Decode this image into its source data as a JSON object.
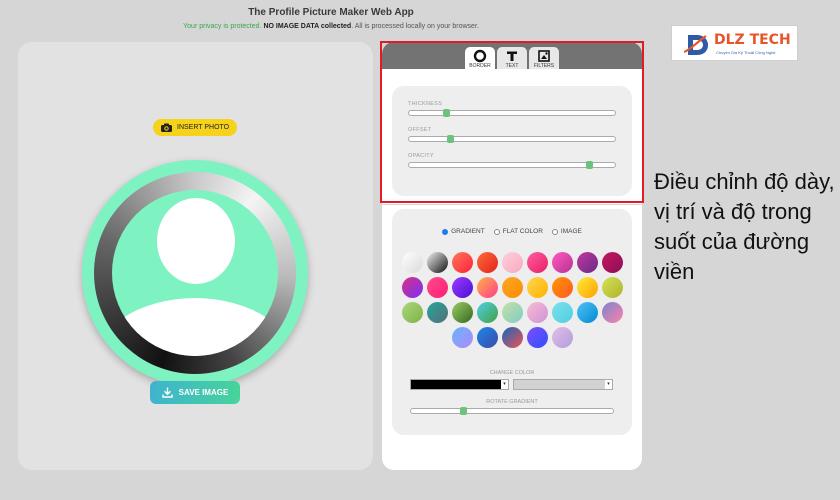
{
  "header": {
    "title": "The Profile Picture Maker Web App",
    "privacy_green": "Your privacy is protected.",
    "privacy_bold": "NO IMAGE DATA collected",
    "privacy_rest": ". All is processed locally on your browser."
  },
  "left": {
    "insert_label": "INSERT PHOTO",
    "save_label": "SAVE IMAGE"
  },
  "tabs": [
    {
      "label": "BORDER",
      "icon": "circle-icon",
      "active": true
    },
    {
      "label": "TEXT",
      "icon": "text-t-icon",
      "active": false
    },
    {
      "label": "FILTERS",
      "icon": "filters-icon",
      "active": false
    }
  ],
  "border_settings": {
    "thickness": {
      "label": "THICKNESS",
      "value": 0.17
    },
    "offset": {
      "label": "OFFSET",
      "value": 0.19
    },
    "opacity": {
      "label": "OPACITY",
      "value": 0.88
    }
  },
  "color_panel": {
    "modes": [
      {
        "label": "GRADIENT",
        "selected": true
      },
      {
        "label": "FLAT COLOR",
        "selected": false
      },
      {
        "label": "IMAGE",
        "selected": false
      }
    ],
    "swatches": [
      "linear-gradient(135deg,#ffffff,#d9d9d9)",
      "linear-gradient(135deg,#f2f2f2,#111111)",
      "linear-gradient(135deg,#ff7a5a,#ff1e3c)",
      "linear-gradient(135deg,#ff6a3d,#e2231a)",
      "linear-gradient(135deg,#ffd1dc,#f7a8c0)",
      "linear-gradient(135deg,#ff5fa2,#e91e63)",
      "linear-gradient(135deg,#ff59c3,#b8338f)",
      "linear-gradient(135deg,#c0399e,#6a2b87)",
      "linear-gradient(135deg,#c2185b,#8e0e5a)",
      "linear-gradient(135deg,#d63384,#7b2ff7)",
      "linear-gradient(135deg,#ff4f8b,#ff1a75)",
      "linear-gradient(135deg,#9b3bff,#4b0fd6)",
      "linear-gradient(135deg,#ffb347,#ff3b8a)",
      "linear-gradient(135deg,#ffa726,#fb8c00)",
      "linear-gradient(135deg,#ffd54f,#ffb300)",
      "linear-gradient(135deg,#ff9800,#ff5722)",
      "linear-gradient(135deg,#ffeb3b,#ffa000)",
      "linear-gradient(135deg,#d4e157,#afb42b)",
      "linear-gradient(135deg,#aed581,#7cb342)",
      "linear-gradient(135deg,#26a69a,#546e7a)",
      "linear-gradient(135deg,#9ccc65,#33691e)",
      "linear-gradient(135deg,#4dd0e1,#43a047)",
      "linear-gradient(135deg,#c5e1a5,#80cbc4)",
      "linear-gradient(135deg,#f8bbd0,#ce93d8)",
      "linear-gradient(135deg,#80deea,#4dd0e1)",
      "linear-gradient(135deg,#4fc3f7,#0288d1)",
      "linear-gradient(135deg,#7986cb,#ff80ab)",
      "linear-gradient(135deg,#64b5f6,#b388ff)",
      "linear-gradient(135deg,#1e88e5,#3949ab)",
      "linear-gradient(135deg,#1565c0,#ef5350)",
      "linear-gradient(135deg,#7c4dff,#304ffe)",
      "linear-gradient(135deg,#e1bee7,#b39ddb)"
    ],
    "change_color_label": "CHANGE COLOR",
    "color1": "#000000",
    "color2": "#d2d2d2",
    "rotate_label": "ROTATE GRADIENT",
    "rotate_value": 0.25
  },
  "logo": {
    "text": "DLZ TECH",
    "tagline": "Chuyên Gia Kỹ Thuật Công Nghệ"
  },
  "caption": "Điều chỉnh độ dày, vị trí và độ trong suốt của đường viền",
  "colors": {
    "avatar_bg": "#7ef3c1",
    "highlight": "#e11b22",
    "slider_knob": "#6fc27e",
    "insert_btn": "#f6d21b"
  }
}
